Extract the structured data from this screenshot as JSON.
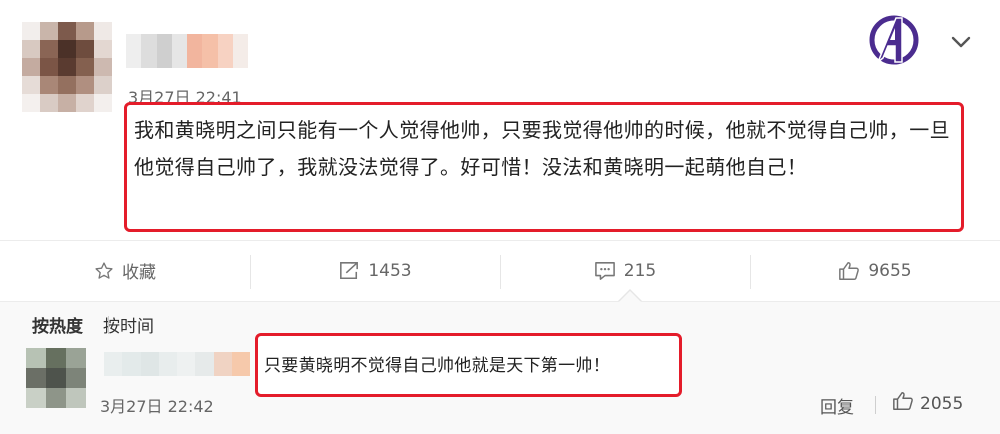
{
  "post": {
    "timestamp": "3月27日 22:41",
    "text": "我和黄晓明之间只能有一个人觉得他帅，只要我觉得他帅的时候，他就不觉得自己帅，一旦他觉得自己帅了，我就没法觉得了。好可惜！没法和黄晓明一起萌他自己！",
    "brand_logo_icon": "avengers-logo-icon",
    "menu_icon": "chevron-down-icon"
  },
  "actions": {
    "favorite": {
      "label": "收藏",
      "icon": "star-icon"
    },
    "repost": {
      "count": "1453",
      "icon": "share-icon"
    },
    "comment": {
      "count": "215",
      "icon": "comment-icon"
    },
    "like": {
      "count": "9655",
      "icon": "thumbs-up-icon"
    }
  },
  "comments": {
    "sort_options": [
      "按热度",
      "按时间"
    ],
    "active_sort": "按热度",
    "items": [
      {
        "text": "只要黄晓明不觉得自己帅他就是天下第一帅！",
        "timestamp": "3月27日 22:42",
        "reply_label": "回复",
        "likes": "2055"
      }
    ]
  },
  "colors": {
    "highlight_frame": "#e41c2a",
    "logo_purple": "#4b2c8f"
  }
}
